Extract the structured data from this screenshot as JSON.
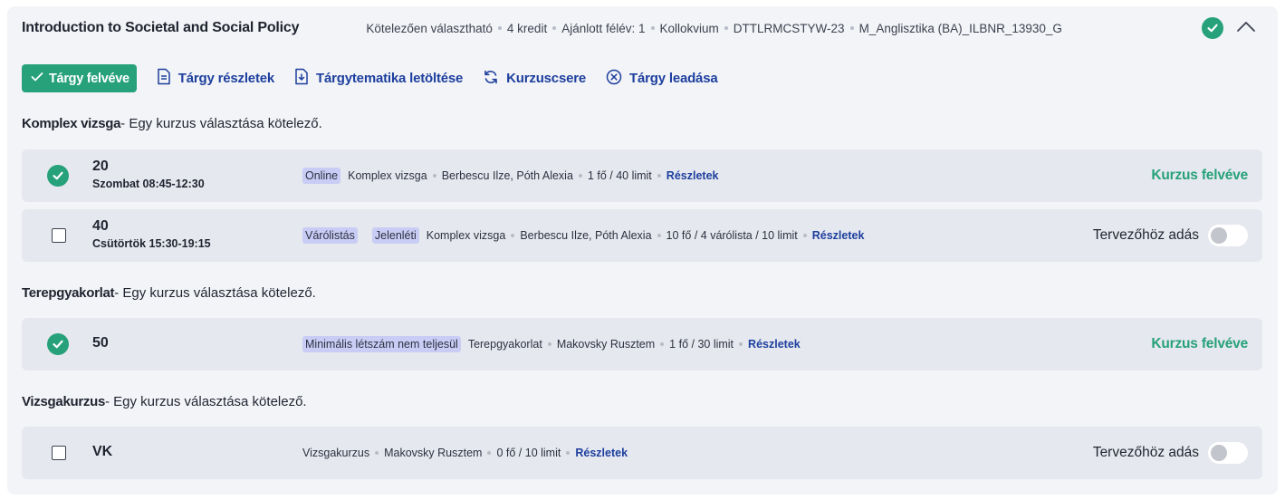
{
  "subject": {
    "title": "Introduction to Societal and Social Policy",
    "meta": [
      "Kötelezően választható",
      "4 kredit",
      "Ajánlott félév: 1",
      "Kollokvium",
      "DTTLRMCSTYW-23",
      "M_Anglisztika (BA)_ILBNR_13930_G"
    ],
    "icons": {
      "status": "check-circle-icon",
      "collapse": "chevron-up-icon"
    }
  },
  "actions": {
    "taken_label": "Tárgy felvéve",
    "details_label": "Tárgy részletek",
    "download_label": "Tárgytematika letöltése",
    "swap_label": "Kurzuscsere",
    "drop_label": "Tárgy leadása"
  },
  "sections": [
    {
      "name": "Komplex vizsga",
      "rule": "- Egy kurzus választása kötelező.",
      "courses": [
        {
          "code": "20",
          "time": "Szombat 08:45-12:30",
          "tags": [
            "Online"
          ],
          "info": [
            "Komplex vizsga",
            "Berbescu Ilze, Póth Alexia",
            "1 fő / 40 limit"
          ],
          "link": "Részletek",
          "status": "Kurzus felvéve"
        },
        {
          "code": "40",
          "time": "Csütörtök 15:30-19:15",
          "tags": [
            "Várólistás",
            "Jelenléti"
          ],
          "info": [
            "Komplex vizsga",
            "Berbescu Ilze, Póth Alexia",
            "10 fő / 4 várólista / 10 limit"
          ],
          "link": "Részletek",
          "planner": "Tervezőhöz adás"
        }
      ]
    },
    {
      "name": "Terepgyakorlat",
      "rule": "- Egy kurzus választása kötelező.",
      "courses": [
        {
          "code": "50",
          "tags": [
            "Minimális létszám nem teljesül"
          ],
          "info": [
            "Terepgyakorlat",
            "Makovsky Rusztem",
            "1 fő / 30 limit"
          ],
          "link": "Részletek",
          "status": "Kurzus felvéve"
        }
      ]
    },
    {
      "name": "Vizsgakurzus",
      "rule": "- Egy kurzus választása kötelező.",
      "courses": [
        {
          "code": "VK",
          "info": [
            "Vizsgakurzus",
            "Makovsky Rusztem",
            "0 fő / 10 limit"
          ],
          "link": "Részletek",
          "planner": "Tervezőhöz adás"
        }
      ]
    }
  ],
  "colors": {
    "accent_green": "#26a17a",
    "link_blue": "#1d3f9e",
    "tag_bg": "#c9cdf5",
    "row_bg": "#e6e8ef",
    "card_bg": "#f3f4f7"
  }
}
